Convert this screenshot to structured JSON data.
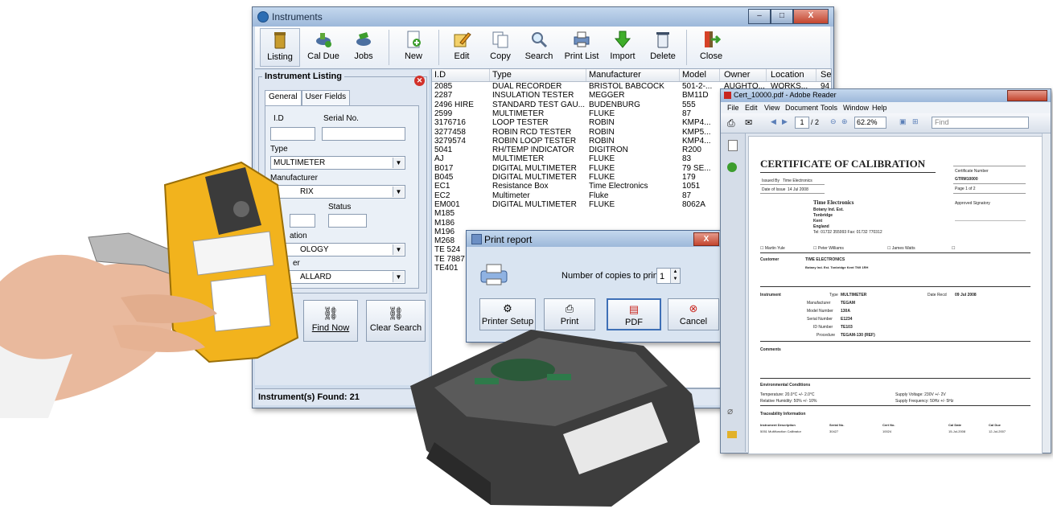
{
  "window": {
    "title": "Instruments",
    "min": "–",
    "max": "□",
    "close": "X"
  },
  "toolbar": [
    {
      "label": "Listing",
      "icon": "bin-icon"
    },
    {
      "label": "Cal Due",
      "icon": "cal-due-icon"
    },
    {
      "label": "Jobs",
      "icon": "jobs-icon"
    },
    {
      "label": "New",
      "icon": "new-icon"
    },
    {
      "label": "Edit",
      "icon": "edit-icon"
    },
    {
      "label": "Copy",
      "icon": "copy-icon"
    },
    {
      "label": "Search",
      "icon": "search-icon"
    },
    {
      "label": "Print List",
      "icon": "print-icon"
    },
    {
      "label": "Import",
      "icon": "import-icon"
    },
    {
      "label": "Delete",
      "icon": "delete-icon"
    },
    {
      "label": "Close",
      "icon": "exit-icon"
    }
  ],
  "panel": {
    "title": "Instrument Listing",
    "tabs": [
      "General",
      "User Fields"
    ],
    "fields": {
      "id_label": "I.D",
      "serial_label": "Serial No.",
      "type_label": "Type",
      "type_value": "MULTIMETER",
      "manufacturer_label": "Manufacturer",
      "manufacturer_value": "RIX",
      "status_label": "Status",
      "location_label": "ation",
      "location_value": "OLOGY",
      "owner_label": "er",
      "owner_value": "ALLARD"
    },
    "find_now": "Find Now",
    "clear_search": "Clear Search"
  },
  "status": "Instrument(s) Found: 21",
  "listing": {
    "columns": [
      "I.D",
      "Type",
      "Manufacturer",
      "Model",
      "Owner",
      "Location",
      "Se"
    ],
    "rows": [
      [
        "2085",
        "DUAL RECORDER",
        "BRISTOL BABCOCK",
        "501-2-...",
        "AUGHTO...",
        "WORKS...",
        "94"
      ],
      [
        "2287",
        "INSULATION TESTER",
        "MEGGER",
        "BM11D",
        "",
        "",
        ""
      ],
      [
        "2496 HIRE",
        "STANDARD TEST GAU...",
        "BUDENBURG",
        "555",
        "",
        "",
        ""
      ],
      [
        "2599",
        "MULTIMETER",
        "FLUKE",
        "87",
        "",
        "",
        ""
      ],
      [
        "3176716",
        "LOOP TESTER",
        "ROBIN",
        "KMP4...",
        "",
        "",
        ""
      ],
      [
        "3277458",
        "ROBIN RCD TESTER",
        "ROBIN",
        "KMP5...",
        "",
        "",
        ""
      ],
      [
        "3279574",
        "ROBIN LOOP TESTER",
        "ROBIN",
        "KMP4...",
        "",
        "",
        ""
      ],
      [
        "5041",
        "RH/TEMP INDICATOR",
        "DIGITRON",
        "R200",
        "",
        "",
        ""
      ],
      [
        "AJ",
        "MULTIMETER",
        "FLUKE",
        "83",
        "",
        "",
        ""
      ],
      [
        "B017",
        "DIGITAL MULTIMETER",
        "FLUKE",
        "79 SE...",
        "",
        "",
        ""
      ],
      [
        "B045",
        "DIGITAL MULTIMETER",
        "FLUKE",
        "179",
        "",
        "",
        ""
      ],
      [
        "EC1",
        "Resistance Box",
        "Time Electronics",
        "1051",
        "",
        "",
        ""
      ],
      [
        "EC2",
        "Multimeter",
        "Fluke",
        "87",
        "",
        "",
        ""
      ],
      [
        "EM001",
        "DIGITAL MULTIMETER",
        "FLUKE",
        "8062A",
        "",
        "",
        ""
      ],
      [
        "M185",
        "",
        "",
        "",
        "",
        "",
        ""
      ],
      [
        "M186",
        "",
        "",
        "",
        "",
        "",
        ""
      ],
      [
        "M196",
        "",
        "",
        "",
        "",
        "",
        ""
      ],
      [
        "M268",
        "",
        "",
        "",
        "",
        "",
        ""
      ],
      [
        "TE 524",
        "",
        "",
        "",
        "",
        "",
        ""
      ],
      [
        "TE 7887",
        "",
        "",
        "",
        "",
        "",
        ""
      ],
      [
        "TE401",
        "",
        "",
        "",
        "",
        "",
        ""
      ]
    ]
  },
  "print_dialog": {
    "title": "Print report",
    "copies_label": "Number of copies to print:",
    "copies_value": "1",
    "buttons": [
      "Printer Setup",
      "Print",
      "PDF",
      "Cancel"
    ]
  },
  "reader": {
    "title": "Cert_10000.pdf - Adobe Reader",
    "menu": [
      "File",
      "Edit",
      "View",
      "Document",
      "Tools",
      "Window",
      "Help"
    ],
    "page_current": "1",
    "page_total": "/ 2",
    "zoom": "62.2%",
    "find": "Find",
    "cert": {
      "heading": "CERTIFICATE OF CALIBRATION",
      "issued_by_label": "Issued By",
      "issued_by": "Time Electronics",
      "date_issue_label": "Date of Issue",
      "date_issue": "14 Jul 2008",
      "cert_no_label": "Certificate Number",
      "cert_no": "GTRM10000",
      "page_of": "Page 1 of 2",
      "approved": "Approved Signatory",
      "company": "Time Electronics",
      "addr1": "Botany Ind. Est.",
      "addr2": "Tonbridge",
      "addr3": "Kent",
      "addr4": "England",
      "tel": "Tel: 01732 355993  Fax: 01732 770312",
      "signers": [
        "Martin Yule",
        "Peter Williams",
        "James Watts"
      ],
      "customer_label": "Customer",
      "customer": "TIME ELECTRONICS",
      "customer_addr": "Botany Ind. Est.  Tonbridge  Kent  TN9 1RH",
      "instrument_label": "Instrument",
      "type_label": "Type",
      "type": "MULTIMETER",
      "date_recd_label": "Date Recd",
      "date_recd": "09 Jul 2008",
      "manufacturer_label": "Manufacturer",
      "manufacturer": "TEGAM",
      "model_label": "Model Number",
      "model": "130A",
      "serial_label": "Serial Number",
      "serial": "E1234",
      "id_label": "ID Number",
      "id": "TE103",
      "procedure_label": "Procedure",
      "procedure": "TEGAM-130 (REF)",
      "comments": "Comments",
      "env": "Environmental Conditions",
      "temp": "Temperature: 20.0°C +/- 2.0°C",
      "humidity": "Relative Humidity: 50%  +/- 10%",
      "voltage": "Supply Voltage: 230V +/- 2V",
      "frequency": "Supply Frequency: 50Hz +/- 5Hz",
      "trace": "Traceability Information",
      "trace_cols": [
        "Instrument Description",
        "Serial No.",
        "Cert No.",
        "Cal Date",
        "Cal Due"
      ],
      "trace_row": [
        "5051 Multifunction Calibrator",
        "30427",
        "10024",
        "15-Jul-2008",
        "12-Jul-2007"
      ]
    }
  },
  "colors": {
    "accent": "#3e6fb6",
    "close": "#c3452e",
    "title": "#9db8da"
  }
}
